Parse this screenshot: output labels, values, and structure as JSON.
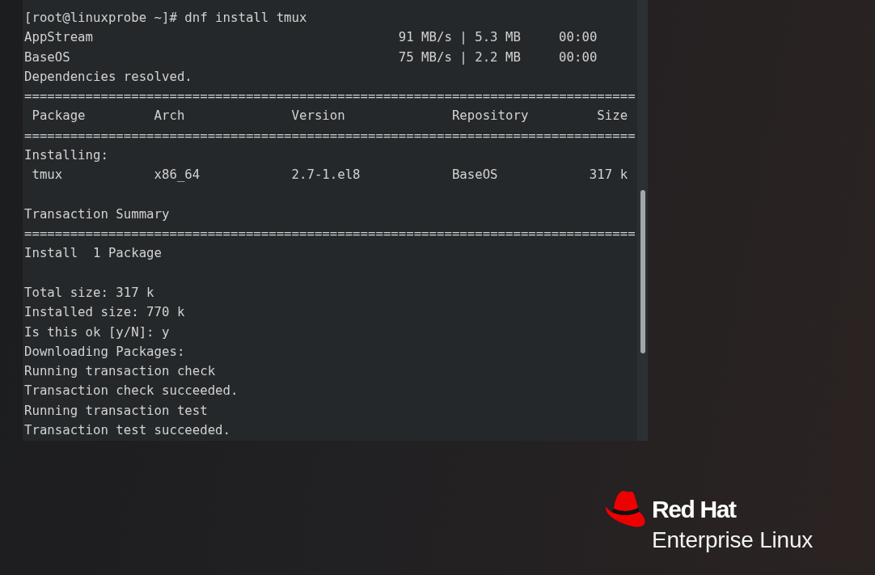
{
  "terminal": {
    "lines": [
      {
        "kind": "command",
        "text": "[root@linuxprobe ~]# dnf install tmux"
      },
      {
        "kind": "repo",
        "name": "AppStream",
        "transfer": "91 MB/s | 5.3 MB",
        "time": "00:00"
      },
      {
        "kind": "repo",
        "name": "BaseOS",
        "transfer": "75 MB/s | 2.2 MB",
        "time": "00:00"
      },
      {
        "kind": "text",
        "text": "Dependencies resolved."
      },
      {
        "kind": "rule",
        "text": "================================================================================"
      },
      {
        "kind": "header",
        "cells": [
          "Package",
          "Arch",
          "Version",
          "Repository",
          "Size"
        ]
      },
      {
        "kind": "rule",
        "text": "================================================================================"
      },
      {
        "kind": "text",
        "text": "Installing:"
      },
      {
        "kind": "row",
        "cells": [
          "tmux",
          "x86_64",
          "2.7-1.el8",
          "BaseOS",
          "317 k"
        ]
      },
      {
        "kind": "blank"
      },
      {
        "kind": "text",
        "text": "Transaction Summary"
      },
      {
        "kind": "rule",
        "text": "================================================================================"
      },
      {
        "kind": "text",
        "text": "Install  1 Package"
      },
      {
        "kind": "blank"
      },
      {
        "kind": "text",
        "text": "Total size: 317 k"
      },
      {
        "kind": "text",
        "text": "Installed size: 770 k"
      },
      {
        "kind": "text",
        "text": "Is this ok [y/N]: y"
      },
      {
        "kind": "text",
        "text": "Downloading Packages:"
      },
      {
        "kind": "text",
        "text": "Running transaction check"
      },
      {
        "kind": "text",
        "text": "Transaction check succeeded."
      },
      {
        "kind": "text",
        "text": "Running transaction test"
      },
      {
        "kind": "text",
        "text": "Transaction test succeeded."
      }
    ]
  },
  "logo": {
    "brand": "Red Hat",
    "product": "Enterprise Linux"
  }
}
